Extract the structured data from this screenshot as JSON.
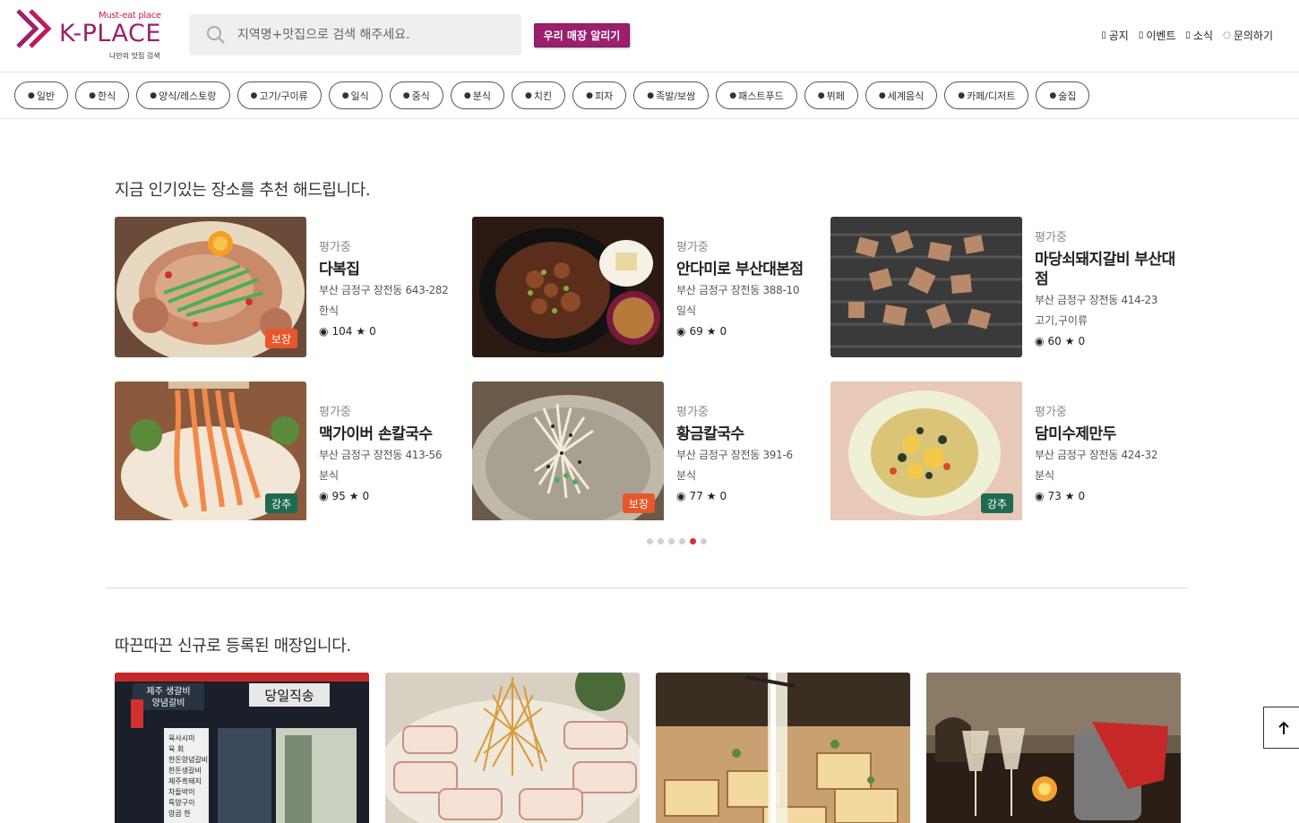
{
  "header": {
    "logo": {
      "tagline": "Must-eat place",
      "name": "K-PLACE",
      "sub": "나만의 맛집 검색"
    },
    "search": {
      "placeholder": "지역명+맛집으로 검색 해주세요."
    },
    "promo_button": "우리 매장 알리기",
    "nav": [
      {
        "label": "공지",
        "icon": "document-icon"
      },
      {
        "label": "이벤트",
        "icon": "document-icon"
      },
      {
        "label": "소식",
        "icon": "document-icon"
      },
      {
        "label": "문의하기",
        "icon": "chat-icon"
      }
    ]
  },
  "categories": [
    "일반",
    "한식",
    "양식/레스토랑",
    "고기/구이류",
    "일식",
    "중식",
    "분식",
    "치킨",
    "피자",
    "족발/보쌈",
    "패스트푸드",
    "뷔페",
    "세계음식",
    "카페/디저트",
    "술집"
  ],
  "popular": {
    "title": "지금 인기있는 장소를 추천 해드립니다.",
    "cards": [
      {
        "status": "평가중",
        "name": "다복집",
        "address": "부산 금정구 장전동 643-282",
        "category": "한식",
        "views": "104",
        "stars": "0",
        "badge": "보장",
        "badge_color": "#e8562a"
      },
      {
        "status": "평가중",
        "name": "안다미로 부산대본점",
        "address": "부산 금정구 장전동 388-10",
        "category": "일식",
        "views": "69",
        "stars": "0",
        "badge": "",
        "badge_color": ""
      },
      {
        "status": "평가중",
        "name": "마당쇠돼지갈비 부산대점",
        "address": "부산 금정구 장전동 414-23",
        "category": "고기,구이류",
        "views": "60",
        "stars": "0",
        "badge": "",
        "badge_color": ""
      },
      {
        "status": "평가중",
        "name": "맥가이버 손칼국수",
        "address": "부산 금정구 장전동 413-56",
        "category": "분식",
        "views": "95",
        "stars": "0",
        "badge": "강추",
        "badge_color": "#1e6b52"
      },
      {
        "status": "평가중",
        "name": "황금칼국수",
        "address": "부산 금정구 장전동 391-6",
        "category": "분식",
        "views": "77",
        "stars": "0",
        "badge": "보장",
        "badge_color": "#e8562a"
      },
      {
        "status": "평가중",
        "name": "담미수제만두",
        "address": "부산 금정구 장전동 424-32",
        "category": "분식",
        "views": "73",
        "stars": "0",
        "badge": "강추",
        "badge_color": "#1e6b52"
      }
    ],
    "carousel": {
      "total": 6,
      "active": 5
    }
  },
  "new_stores": {
    "title": "따끈따끈 신규로 등록된 매장입니다.",
    "signs": {
      "left_top": "제주 생갈비",
      "left_mid": "양념갈비",
      "main": "당일직송",
      "menu": [
        "육사시미",
        "육 회",
        "한돈양념갈비",
        "한돈생갈비",
        "제주흑돼지",
        "차돌박이",
        "특양구이",
        "양곱 한"
      ]
    }
  },
  "colors": {
    "brand": "#9c1f6e",
    "active_dot": "#d32f2f"
  }
}
